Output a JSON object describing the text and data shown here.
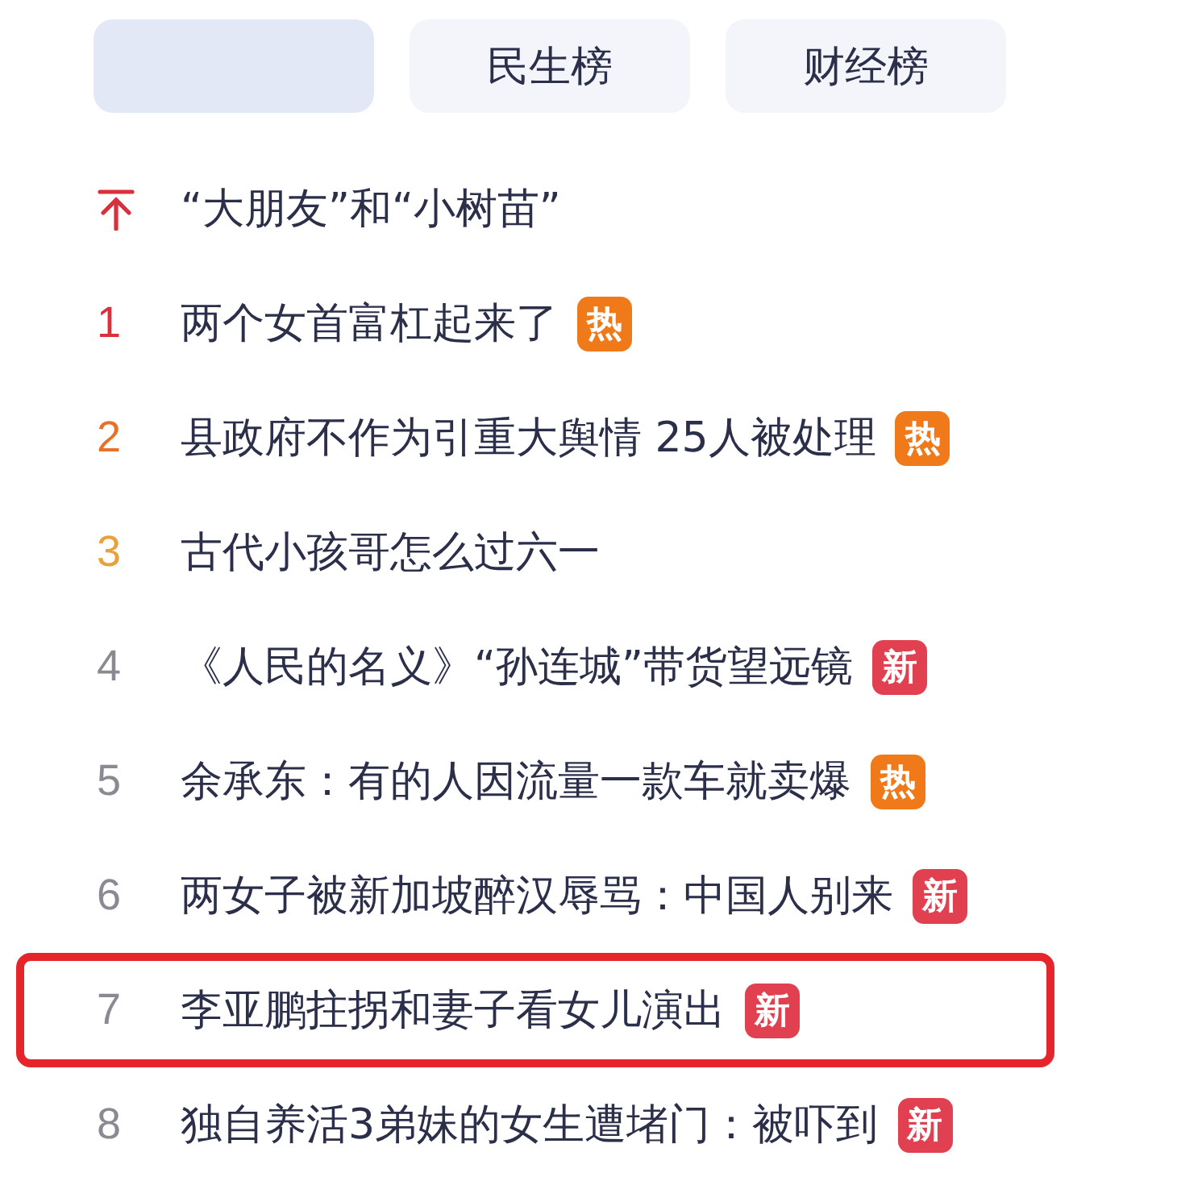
{
  "tabs": [
    {
      "selected": true
    },
    {
      "label": "民生榜",
      "selected": false
    },
    {
      "label": "财经榜",
      "selected": false
    }
  ],
  "items": [
    {
      "kind": "pinned",
      "color": "#d9303b",
      "title": "“大朋友”和“小树苗”",
      "highlighted": false
    },
    {
      "kind": "ranked",
      "rank": "1",
      "color": "#d9303b",
      "title": "两个女首富杠起来了",
      "badge": {
        "kind": "hot",
        "label": "热"
      },
      "highlighted": false
    },
    {
      "kind": "ranked",
      "rank": "2",
      "color": "#e8702a",
      "title": "县政府不作为引重大舆情 25人被处理",
      "badge": {
        "kind": "hot",
        "label": "热"
      },
      "highlighted": false
    },
    {
      "kind": "ranked",
      "rank": "3",
      "color": "#e9a23b",
      "title": "古代小孩哥怎么过六一",
      "highlighted": false
    },
    {
      "kind": "ranked",
      "rank": "4",
      "color": "#8a8a93",
      "title": "《人民的名义》“孙连城”带货望远镜",
      "badge": {
        "kind": "new",
        "label": "新"
      },
      "highlighted": false
    },
    {
      "kind": "ranked",
      "rank": "5",
      "color": "#8a8a93",
      "title": "余承东：有的人因流量一款车就卖爆",
      "badge": {
        "kind": "hot",
        "label": "热"
      },
      "highlighted": false
    },
    {
      "kind": "ranked",
      "rank": "6",
      "color": "#8a8a93",
      "title": "两女子被新加坡醉汉辱骂：中国人别来",
      "badge": {
        "kind": "new",
        "label": "新"
      },
      "highlighted": false
    },
    {
      "kind": "ranked",
      "rank": "7",
      "color": "#8a8a93",
      "title": "李亚鹏拄拐和妻子看女儿演出",
      "badge": {
        "kind": "new",
        "label": "新"
      },
      "highlighted": true
    },
    {
      "kind": "ranked",
      "rank": "8",
      "color": "#8a8a93",
      "title": "独自养活3弟妹的女生遭堵门：被吓到",
      "badge": {
        "kind": "new",
        "label": "新"
      },
      "highlighted": false
    }
  ]
}
